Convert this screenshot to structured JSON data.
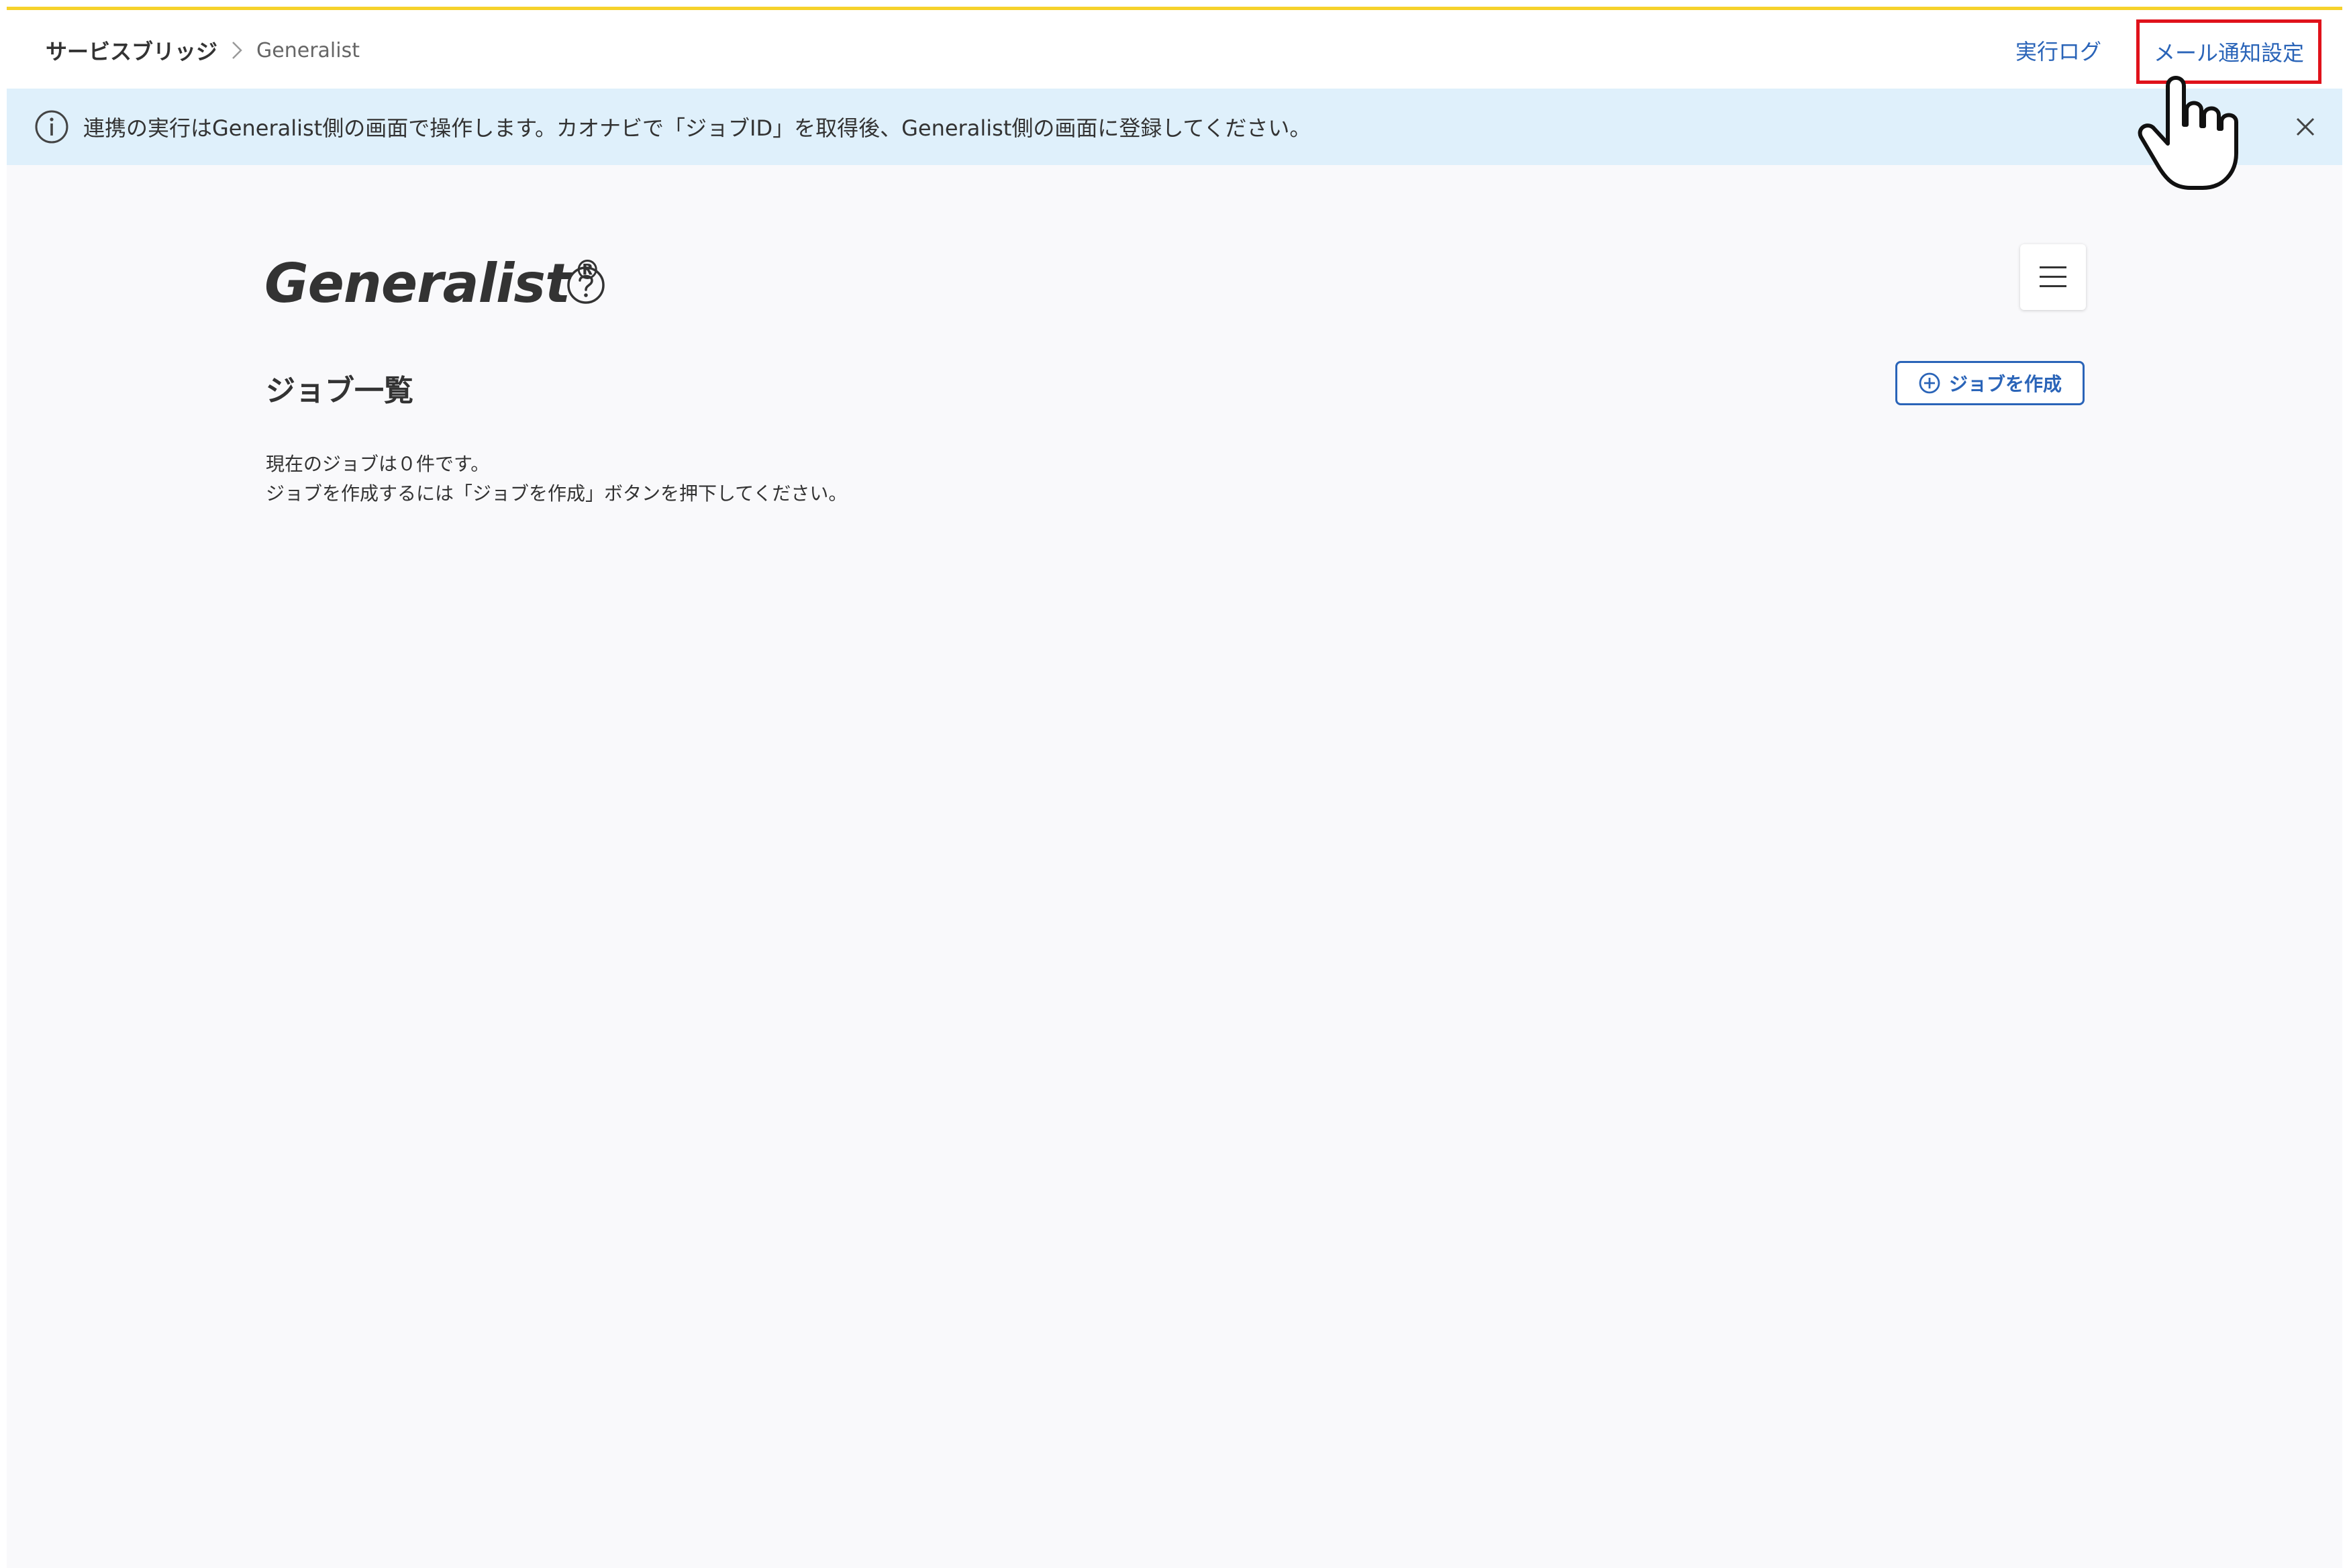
{
  "header": {
    "breadcrumb": {
      "root": "サービスブリッジ",
      "current": "Generalist"
    },
    "links": {
      "execution_log": "実行ログ",
      "mail_settings": "メール通知設定"
    }
  },
  "banner": {
    "message": "連携の実行はGeneralist側の画面で操作します。カオナビで「ジョブID」を取得後、Generalist側の画面に登録してください。",
    "icon": "info-icon"
  },
  "main": {
    "logo": {
      "text": "Generalist",
      "mark": "®"
    },
    "section_title": "ジョブ一覧",
    "create_button_label": "ジョブを作成",
    "empty_message": {
      "line1": "現在のジョブは０件です。",
      "line2": "ジョブを作成するには「ジョブを作成」ボタンを押下してください。"
    }
  },
  "colors": {
    "accent_top": "#f6d22b",
    "link": "#2a64b8",
    "banner_bg": "#dff0fb",
    "highlight": "#e0121b"
  }
}
